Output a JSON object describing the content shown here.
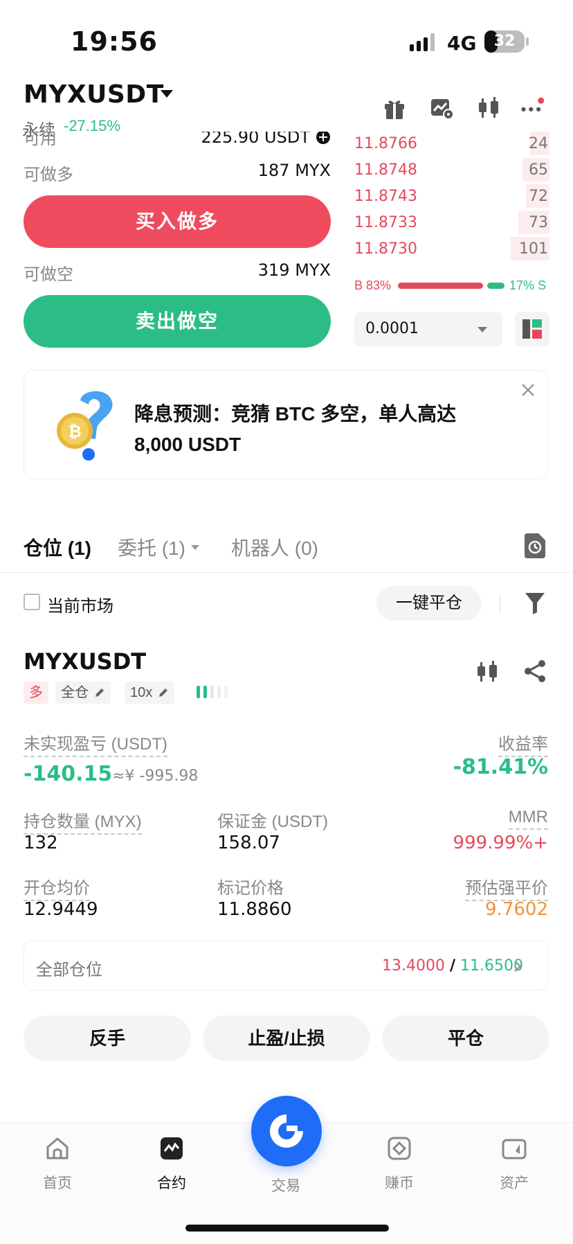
{
  "status_bar": {
    "time": "19:56",
    "network": "4G",
    "battery": "32",
    "battery_level": 0.32
  },
  "header": {
    "pair": "MYXUSDT",
    "contract_type": "永续",
    "change": "-27.15%",
    "icons": [
      "gift-icon",
      "chart-settings-icon",
      "candlestick-icon",
      "more-icon"
    ]
  },
  "trade_panel": {
    "available_label": "可用",
    "available_value": "225.90 USDT",
    "long_label": "可做多",
    "long_value": "187 MYX",
    "buy_button": "买入做多",
    "short_label": "可做空",
    "short_value": "319 MYX",
    "sell_button": "卖出做空"
  },
  "order_book": {
    "asks": [
      {
        "price": "11.8766",
        "qty": "24",
        "depth": 0.1
      },
      {
        "price": "11.8748",
        "qty": "65",
        "depth": 0.14
      },
      {
        "price": "11.8743",
        "qty": "72",
        "depth": 0.12
      },
      {
        "price": "11.8733",
        "qty": "73",
        "depth": 0.16
      },
      {
        "price": "11.8730",
        "qty": "101",
        "depth": 0.2
      }
    ],
    "buy_ratio_label": "B 83%",
    "sell_ratio_label": "17% S",
    "buy_ratio": 0.83,
    "precision": "0.0001"
  },
  "banner": {
    "text": "降息预测：竞猜 BTC 多空，单人高达 8,000 USDT"
  },
  "tabs": [
    {
      "label": "仓位 (1)"
    },
    {
      "label": "委托 (1)"
    },
    {
      "label": "机器人 (0)"
    }
  ],
  "filter": {
    "current_market": "当前市场",
    "close_all": "一键平仓"
  },
  "position": {
    "symbol": "MYXUSDT",
    "side": "多",
    "margin_mode": "全仓",
    "leverage": "10x",
    "unrealized_label": "未实现盈亏 (USDT)",
    "unrealized_value": "-140.15",
    "unrealized_cny": "≈¥ -995.98",
    "roi_label": "收益率",
    "roi_value": "-81.41%",
    "size_label": "持仓数量 (MYX)",
    "size_value": "132",
    "margin_label": "保证金 (USDT)",
    "margin_value": "158.07",
    "mmr_label": "MMR",
    "mmr_value": "999.99%+",
    "entry_label": "开仓均价",
    "entry_value": "12.9449",
    "mark_label": "标记价格",
    "mark_value": "11.8860",
    "liq_label": "预估强平价",
    "liq_value": "9.7602",
    "all_positions_label": "全部仓位",
    "tp_price": "13.4000",
    "separator": "/",
    "sl_price": "11.6500"
  },
  "actions": {
    "reverse": "反手",
    "tpsl": "止盈/止损",
    "close": "平仓"
  },
  "nav": [
    {
      "label": "首页"
    },
    {
      "label": "合约"
    },
    {
      "label": "交易"
    },
    {
      "label": "赚币"
    },
    {
      "label": "资产"
    }
  ],
  "colors": {
    "green": "#2bbd85",
    "red": "#e5495d",
    "orange": "#f0923a",
    "brand_blue": "#1f6cf7"
  }
}
